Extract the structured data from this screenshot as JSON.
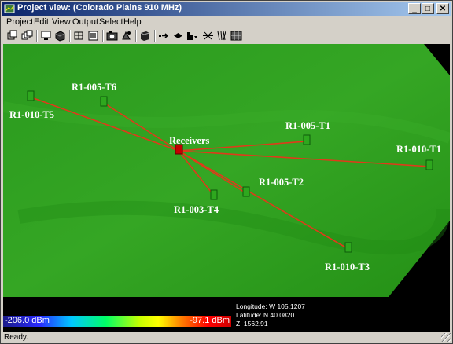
{
  "window": {
    "title": "Project view: (Colorado Plains 910 MHz)",
    "controls": {
      "minimize": "_",
      "maximize": "□",
      "close": "✕"
    }
  },
  "menu": [
    "Project",
    "Edit",
    "View",
    "Output",
    "Select",
    "Help"
  ],
  "toolbar": {
    "icons": [
      "copy-window-icon",
      "tile-windows-icon",
      "monitor-icon",
      "solid-view-icon",
      "wireframe-icon",
      "camera-icon",
      "render-icon",
      "layers-icon",
      "arrow-right-icon",
      "diamond-move-icon",
      "bar-dropdown-icon",
      "sparkle-icon",
      "ray-trace-icon",
      "grid-icon"
    ]
  },
  "scene": {
    "receiver_label": "Receivers",
    "transmitters": [
      "R1-010-T5",
      "R1-005-T6",
      "R1-005-T1",
      "R1-010-T1",
      "R1-005-T2",
      "R1-003-T4",
      "R1-010-T3"
    ],
    "colors": {
      "terrain": "#2f9b22",
      "ray": "#e03a1a",
      "transmitter": "#2ea81e",
      "receiver": "#c40000"
    }
  },
  "legend": {
    "min_label": "-206.0 dBm",
    "max_label": "-97.1 dBm"
  },
  "location": {
    "longitude": "Longitude: W  105.1207",
    "latitude": "Latitude: N  40.0820",
    "z": "Z: 1562.91"
  },
  "status": {
    "text": "Ready."
  }
}
